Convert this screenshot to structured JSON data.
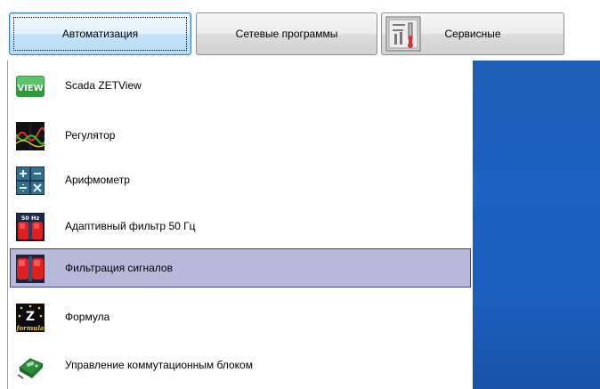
{
  "tabs": [
    {
      "label": "Автоматизация",
      "active": true
    },
    {
      "label": "Сетевые программы",
      "active": false
    },
    {
      "label": "Сервисные",
      "active": false,
      "icon": "tools-panel-icon"
    }
  ],
  "menu": {
    "items": [
      {
        "label": "Scada ZETView",
        "icon": "zetview-icon",
        "icon_text": "VIEW"
      },
      {
        "label": "Регулятор",
        "icon": "regulator-waveform-icon"
      },
      {
        "label": "Арифмометр",
        "icon": "arithmometer-calculator-icon"
      },
      {
        "label": "Адаптивный фильтр 50 Гц",
        "icon": "adaptive-filter-icon",
        "icon_text": "50 Hz"
      },
      {
        "label": "Фильтрация сигналов",
        "icon": "signal-filter-icon",
        "selected": true
      },
      {
        "label": "Формула",
        "icon": "formula-icon",
        "icon_text": "Z",
        "icon_caption": "formula"
      },
      {
        "label": "Управление коммутационным блоком",
        "icon": "switch-block-control-icon"
      }
    ]
  },
  "colors": {
    "selection_fill": "#b6bad8",
    "selection_border": "#3f4a7a",
    "desktop_blue": "#1a61c2",
    "active_tab": "#c4e3f7"
  }
}
